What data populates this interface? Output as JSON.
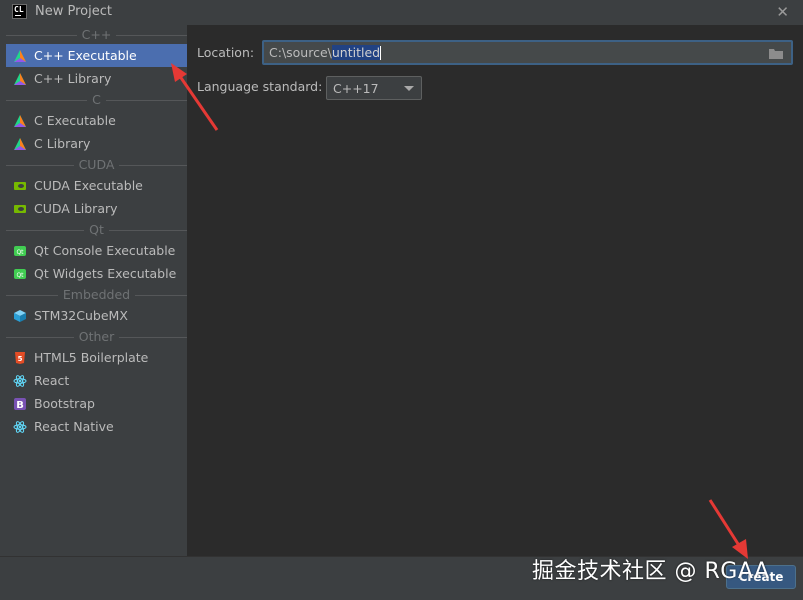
{
  "window": {
    "title": "New Project",
    "logo_text": "CL",
    "close_glyph": "✕"
  },
  "sidebar": {
    "groups": [
      {
        "header": "C++",
        "items": [
          {
            "label": "C++ Executable",
            "icon": "clion-triangle-icon",
            "selected": true
          },
          {
            "label": "C++ Library",
            "icon": "clion-triangle-icon"
          }
        ]
      },
      {
        "header": "C",
        "items": [
          {
            "label": "C Executable",
            "icon": "clion-triangle-icon"
          },
          {
            "label": "C Library",
            "icon": "clion-triangle-icon"
          }
        ]
      },
      {
        "header": "CUDA",
        "items": [
          {
            "label": "CUDA Executable",
            "icon": "nvidia-icon"
          },
          {
            "label": "CUDA Library",
            "icon": "nvidia-icon"
          }
        ]
      },
      {
        "header": "Qt",
        "items": [
          {
            "label": "Qt Console Executable",
            "icon": "qt-icon"
          },
          {
            "label": "Qt Widgets Executable",
            "icon": "qt-icon"
          }
        ]
      },
      {
        "header": "Embedded",
        "items": [
          {
            "label": "STM32CubeMX",
            "icon": "cube-icon"
          }
        ]
      },
      {
        "header": "Other",
        "items": [
          {
            "label": "HTML5 Boilerplate",
            "icon": "html5-icon"
          },
          {
            "label": "React",
            "icon": "react-icon"
          },
          {
            "label": "Bootstrap",
            "icon": "bootstrap-icon"
          },
          {
            "label": "React Native",
            "icon": "react-icon"
          }
        ]
      }
    ]
  },
  "form": {
    "location_label": "Location:",
    "location_prefix": "C:\\source\\",
    "location_selected": "untitled",
    "language_label": "Language standard:",
    "language_value": "C++17"
  },
  "footer": {
    "create_label": "Create"
  },
  "watermark": "掘金技术社区 @ RGAA",
  "colors": {
    "selection": "#4b6eaf",
    "editor_bg": "#2b2b2b",
    "panel_bg": "#3c3f41",
    "annotation_arrow": "#e53935"
  }
}
